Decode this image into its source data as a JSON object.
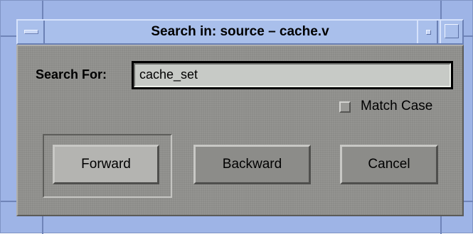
{
  "window": {
    "title": "Search in: source – cache.v"
  },
  "search": {
    "label": "Search For:",
    "value": "cache_set"
  },
  "options": {
    "match_case_label": "Match Case",
    "match_case_checked": false
  },
  "buttons": {
    "forward": "Forward",
    "backward": "Backward",
    "cancel": "Cancel"
  },
  "colors": {
    "window_frame": "#9eb4e6",
    "dialog_body": "#8c8c89",
    "input_bg": "#c7cac6"
  }
}
